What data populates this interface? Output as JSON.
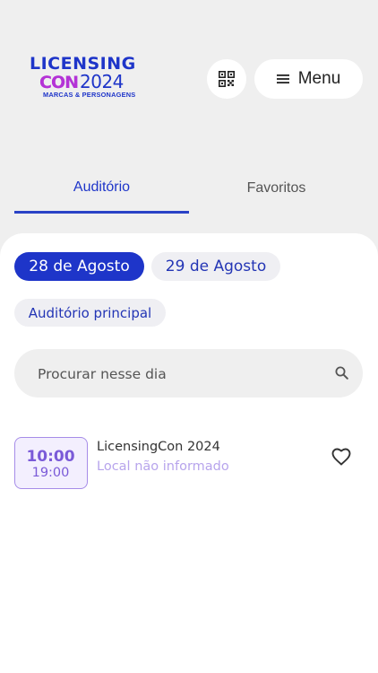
{
  "header": {
    "logo": {
      "line1": "LICENSING",
      "con": "CON",
      "year": "2024",
      "tagline": "MARCAS & PERSONAGENS"
    },
    "qr_icon": "qr-code-icon",
    "menu_icon": "hamburger-icon",
    "menu_label": "Menu"
  },
  "tabs": [
    {
      "label": "Auditório",
      "active": true
    },
    {
      "label": "Favoritos",
      "active": false
    }
  ],
  "filters": {
    "dates": [
      {
        "label": "28 de Agosto",
        "selected": true
      },
      {
        "label": "29 de Agosto",
        "selected": false
      }
    ],
    "room": "Auditório principal"
  },
  "search": {
    "placeholder": "Procurar nesse dia",
    "value": "",
    "icon": "search-icon"
  },
  "events": [
    {
      "start": "10:00",
      "end": "19:00",
      "title": "LicensingCon 2024",
      "location": "Local não informado",
      "favorite": false
    }
  ],
  "colors": {
    "brand_blue": "#1e35c9",
    "brand_purple": "#b433d6",
    "event_accent": "#7a5ad8",
    "background": "#efefef"
  }
}
